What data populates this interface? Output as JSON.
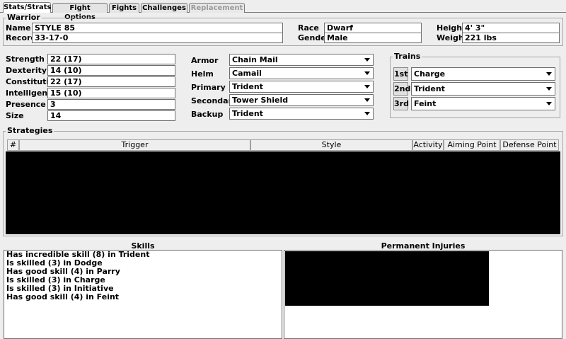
{
  "tabs": [
    {
      "label": "Stats/Strats"
    },
    {
      "label": "Fight Options"
    },
    {
      "label": "Fights"
    },
    {
      "label": "Challenges"
    },
    {
      "label": "Replacement"
    }
  ],
  "warrior": {
    "legend": "Warrior",
    "name_label": "Name",
    "name_value": "STYLE 85",
    "record_label": "Record",
    "record_value": "33-17-0",
    "race_label": "Race",
    "race_value": "Dwarf",
    "gender_label": "Gender",
    "gender_value": "Male",
    "height_label": "Height",
    "height_value": "4' 3\"",
    "weight_label": "Weight",
    "weight_value": "221 lbs"
  },
  "stats": [
    {
      "label": "Strength",
      "value": "22 (17)"
    },
    {
      "label": "Dexterity",
      "value": "14 (10)"
    },
    {
      "label": "Constitution",
      "value": "22 (17)"
    },
    {
      "label": "Intelligence",
      "value": "15 (10)"
    },
    {
      "label": "Presence",
      "value": "3"
    },
    {
      "label": "Size",
      "value": "14"
    }
  ],
  "equipment": [
    {
      "label": "Armor",
      "value": "Chain Mail"
    },
    {
      "label": "Helm",
      "value": "Camail"
    },
    {
      "label": "Primary",
      "value": "Trident"
    },
    {
      "label": "Secondary",
      "value": "Tower Shield"
    },
    {
      "label": "Backup",
      "value": "Trident"
    }
  ],
  "trains": {
    "legend": "Trains",
    "items": [
      {
        "button": "1st",
        "value": "Charge"
      },
      {
        "button": "2nd",
        "value": "Trident"
      },
      {
        "button": "3rd",
        "value": "Feint"
      }
    ]
  },
  "strategies": {
    "legend": "Strategies",
    "columns": [
      "#",
      "Trigger",
      "Style",
      "Activity",
      "Aiming Point",
      "Defense Point"
    ]
  },
  "skills": {
    "title": "Skills",
    "items": [
      "Has incredible skill (8) in Trident",
      "Is skilled (3) in Dodge",
      "Has good skill (4) in Parry",
      "Is skilled (3) in Charge",
      "Is skilled (3) in Initiative",
      "Has good skill (4) in Feint"
    ]
  },
  "injuries": {
    "title": "Permanent Injuries"
  }
}
